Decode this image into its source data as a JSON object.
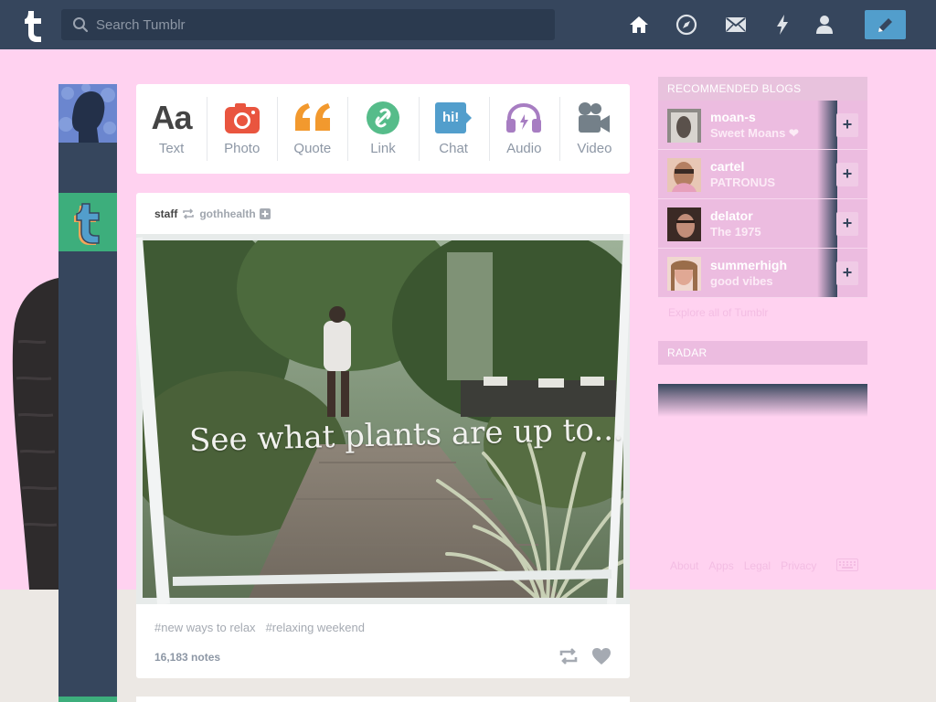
{
  "search": {
    "placeholder": "Search Tumblr"
  },
  "nav": {
    "icons": [
      "home-icon",
      "explore-icon",
      "messages-icon",
      "activity-icon",
      "account-icon"
    ],
    "compose_icon": "pencil-icon"
  },
  "colors": {
    "navy": "#36465d",
    "pink_backdrop": "#ffd2f0",
    "compose_blue": "#529ecc",
    "photo_red": "#e9553f",
    "quote_orange": "#f2992e",
    "link_green": "#56bc8a",
    "chat_blue": "#529ecc",
    "audio_purple": "#a77dc2",
    "video_gray": "#748089"
  },
  "post_types": [
    {
      "label": "Text",
      "icon": "text-icon"
    },
    {
      "label": "Photo",
      "icon": "camera-icon"
    },
    {
      "label": "Quote",
      "icon": "quote-icon"
    },
    {
      "label": "Link",
      "icon": "link-icon"
    },
    {
      "label": "Chat",
      "icon": "chat-icon",
      "glyph": "hi!"
    },
    {
      "label": "Audio",
      "icon": "headphones-icon"
    },
    {
      "label": "Video",
      "icon": "video-camera-icon"
    }
  ],
  "text_glyph": "Aa",
  "post": {
    "blog": "staff",
    "reblogged_from": "gothhealth",
    "caption": "See what plants are up to...",
    "tags": [
      "#new ways to relax",
      "#relaxing weekend"
    ],
    "notes": "16,183 notes"
  },
  "recommended": {
    "title": "RECOMMENDED BLOGS",
    "blogs": [
      {
        "name": "moan-s",
        "desc": "Sweet Moans ❤"
      },
      {
        "name": "cartel",
        "desc": "PATRONUS"
      },
      {
        "name": "delator",
        "desc": "The 1975"
      },
      {
        "name": "summerhigh",
        "desc": "good vibes"
      }
    ],
    "follow_label": "+",
    "explore": "Explore all of Tumblr"
  },
  "radar": {
    "title": "RADAR"
  },
  "footer": {
    "links": [
      "About",
      "Apps",
      "Legal",
      "Privacy"
    ]
  }
}
